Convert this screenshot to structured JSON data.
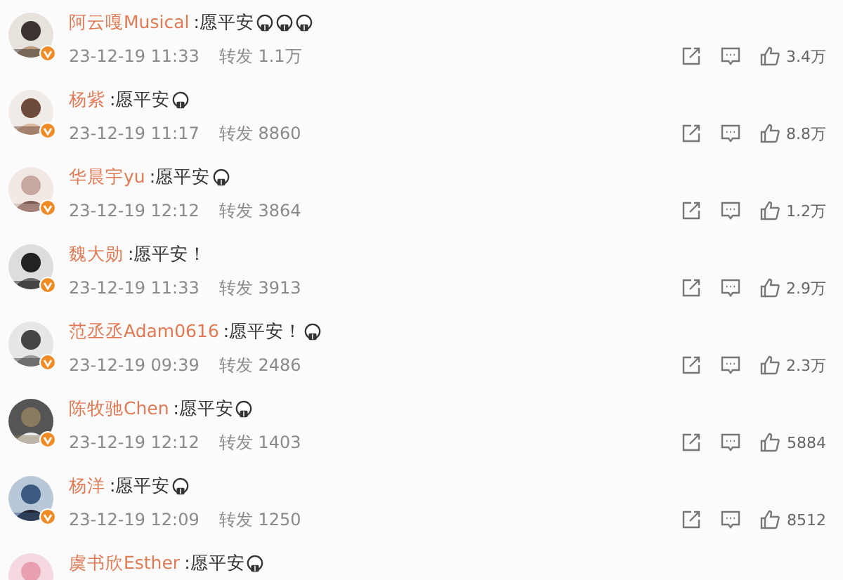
{
  "comments": [
    {
      "name": "阿云嘎Musical",
      "text": ":愿平安",
      "emojis": [
        {
          "kind": "pray"
        },
        {
          "kind": "pray"
        },
        {
          "kind": "pray"
        }
      ],
      "time": "23-12-19 11:33",
      "repost_label": "转发",
      "reposts": "1.1万",
      "likes": "3.4万"
    },
    {
      "name": "杨紫",
      "text": ":愿平安",
      "emojis": [
        {
          "kind": "pray"
        }
      ],
      "time": "23-12-19 11:17",
      "repost_label": "转发",
      "reposts": "8860",
      "likes": "8.8万"
    },
    {
      "name": "华晨宇yu",
      "text": ":愿平安",
      "emojis": [
        {
          "kind": "pray"
        }
      ],
      "time": "23-12-19 12:12",
      "repost_label": "转发",
      "reposts": "3864",
      "likes": "1.2万"
    },
    {
      "name": "魏大勋",
      "text": ":愿平安！",
      "time": "23-12-19 11:33",
      "repost_label": "转发",
      "reposts": "3913",
      "likes": "2.9万"
    },
    {
      "name": "范丞丞Adam0616",
      "text": ":愿平安！",
      "emojis": [
        {
          "kind": "pray"
        }
      ],
      "time": "23-12-19 09:39",
      "repost_label": "转发",
      "reposts": "2486",
      "likes": "2.3万"
    },
    {
      "name": "陈牧驰Chen",
      "text": ":愿平安",
      "emojis": [
        {
          "kind": "pray"
        }
      ],
      "time": "23-12-19 12:12",
      "repost_label": "转发",
      "reposts": "1403",
      "likes": "5884"
    },
    {
      "name": "杨洋",
      "text": ":愿平安",
      "emojis": [
        {
          "kind": "pray"
        }
      ],
      "time": "23-12-19 12:09",
      "repost_label": "转发",
      "reposts": "1250",
      "likes": "8512"
    },
    {
      "name": "虞书欣Esther",
      "text": ":愿平安",
      "emojis": [
        {
          "kind": "pray"
        }
      ]
    }
  ]
}
